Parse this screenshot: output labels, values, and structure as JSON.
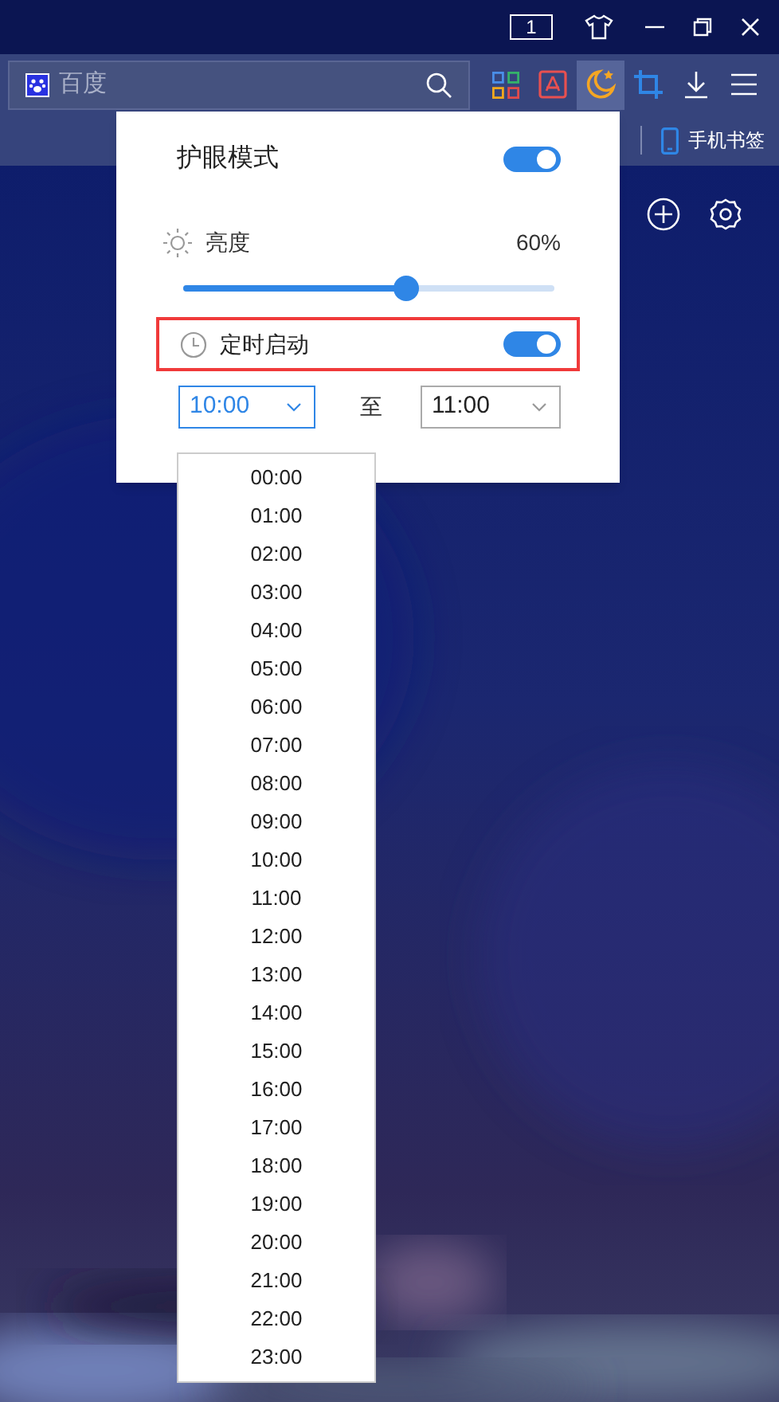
{
  "title_bar": {
    "tab_count": "1"
  },
  "toolbar": {
    "search": {
      "placeholder": "百度"
    },
    "tools": [
      {
        "kind": "apps",
        "selected": false
      },
      {
        "kind": "pdf",
        "selected": false
      },
      {
        "kind": "eye_care",
        "selected": true
      },
      {
        "kind": "crop",
        "selected": false
      },
      {
        "kind": "download",
        "selected": false
      },
      {
        "kind": "menu",
        "selected": false
      }
    ]
  },
  "bookmark_bar": {
    "mobile_bookmarks": "手机书签"
  },
  "eye_care_panel": {
    "title": "护眼模式",
    "on": true,
    "brightness": {
      "label": "亮度",
      "reading": "60%",
      "level": 0.6
    },
    "schedule": {
      "label": "定时启动",
      "on": true,
      "highlighted": true,
      "start": {
        "value": "10:00",
        "open": true
      },
      "separator": "至",
      "end": {
        "value": "11:00",
        "open": false
      }
    }
  },
  "time_dropdown": {
    "options": [
      "00:00",
      "01:00",
      "02:00",
      "03:00",
      "04:00",
      "05:00",
      "06:00",
      "07:00",
      "08:00",
      "09:00",
      "10:00",
      "11:00",
      "12:00",
      "13:00",
      "14:00",
      "15:00",
      "16:00",
      "17:00",
      "18:00",
      "19:00",
      "20:00",
      "21:00",
      "22:00",
      "23:00"
    ]
  }
}
